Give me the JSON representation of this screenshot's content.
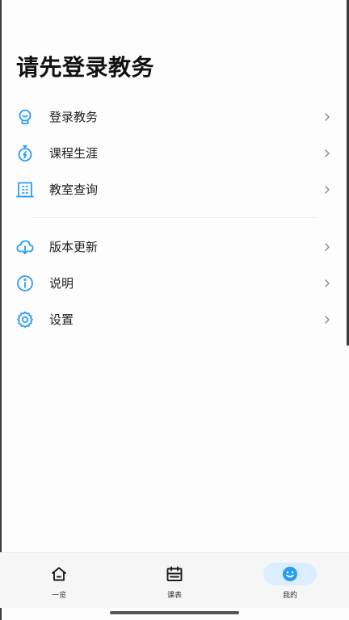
{
  "header": {
    "title": "请先登录教务"
  },
  "menu_group_1": [
    {
      "label": "登录教务",
      "icon": "login-avatar-icon"
    },
    {
      "label": "课程生涯",
      "icon": "stopwatch-icon"
    },
    {
      "label": "教室查询",
      "icon": "building-icon"
    }
  ],
  "menu_group_2": [
    {
      "label": "版本更新",
      "icon": "cloud-download-icon"
    },
    {
      "label": "说明",
      "icon": "info-icon"
    },
    {
      "label": "设置",
      "icon": "gear-icon"
    }
  ],
  "tabbar": [
    {
      "label": "一览",
      "icon": "home-icon",
      "active": false
    },
    {
      "label": "课表",
      "icon": "calendar-icon",
      "active": false
    },
    {
      "label": "我的",
      "icon": "smile-icon",
      "active": true
    }
  ],
  "colors": {
    "accent": "#2a9df4",
    "active_tab_bg": "#dbeeff"
  }
}
